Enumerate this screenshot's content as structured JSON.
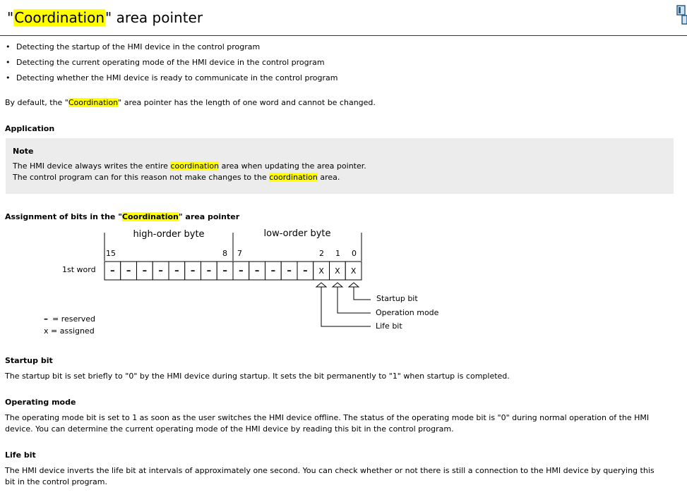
{
  "title": {
    "pre": "\"",
    "highlight": "Coordination",
    "post": "\" area pointer"
  },
  "bullets": [
    "Detecting the startup of the HMI device in the control program",
    "Detecting the current operating mode of the HMI device in the control program",
    "Detecting whether the HMI device is ready to communicate in the control program"
  ],
  "bullet_glyph": "•",
  "default_text": {
    "pre": "By default, the \"",
    "highlight": "Coordination",
    "post": "\" area pointer has the length of one word and cannot be changed."
  },
  "application_heading": "Application",
  "note": {
    "heading": "Note",
    "line1": {
      "pre": "The HMI device always writes the entire ",
      "highlight": "coordination",
      "post": " area when updating the area pointer."
    },
    "line2": {
      "pre": "The control program can for this reason not make changes to the ",
      "highlight": "coordination",
      "post": " area."
    }
  },
  "assignment_heading": {
    "pre": "Assignment of bits in the \"",
    "highlight": "Coordination",
    "post": "\" area pointer"
  },
  "diagram": {
    "high_byte_label": "high-order byte",
    "low_byte_label": "low-order byte",
    "bit_labels": {
      "b15": "15",
      "b8": "8",
      "b7": "7",
      "b2": "2",
      "b1": "1",
      "b0": "0"
    },
    "word_label": "1st word",
    "cells": [
      "–",
      "–",
      "–",
      "–",
      "–",
      "–",
      "–",
      "–",
      "–",
      "–",
      "–",
      "–",
      "–",
      "X",
      "X",
      "X"
    ],
    "startup_label": "Startup bit",
    "operation_label": "Operation mode",
    "life_label": "Life bit",
    "legend_reserved": "= reserved",
    "legend_reserved_symbol": "–",
    "legend_assigned": "x = assigned"
  },
  "startup_heading": "Startup bit",
  "startup_text": "The startup bit is set briefly to \"0\" by the HMI device during startup. It sets the bit permanently to \"1\" when startup is completed.",
  "operating_heading": "Operating mode",
  "operating_text1": "The operating mode bit is set to 1 as soon as the user switches the HMI device offline. The status of the operating mode bit is \"0\" during normal operation of the HMI",
  "operating_text2": "device. You can determine the current operating mode of the HMI device by reading this bit in the control program.",
  "life_heading": "Life bit",
  "life_text1": "The HMI device inverts the life bit at intervals of approximately one second. You can check whether or not there is still a connection to the HMI device by querying this",
  "life_text2": "bit in the control program.",
  "icons": {
    "corner": "window-corner-icon"
  },
  "colors": {
    "highlight": "#ffff00",
    "note_bg": "#ececec"
  }
}
